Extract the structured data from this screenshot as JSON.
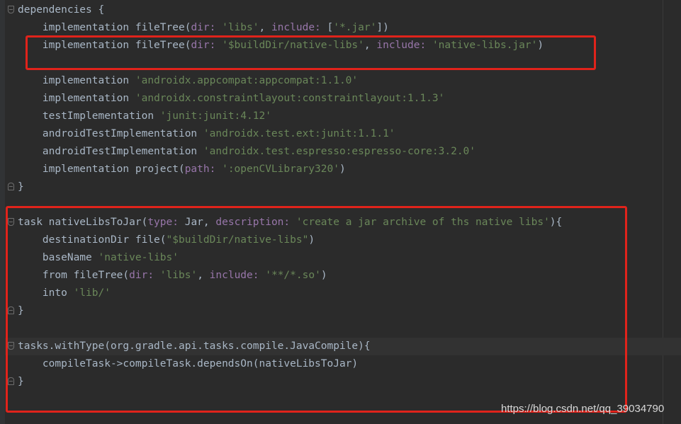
{
  "editor": {
    "lines": [
      {
        "tokens": [
          {
            "t": "dependencies ",
            "c": "plain"
          },
          {
            "t": "{",
            "c": "plain"
          }
        ]
      },
      {
        "tokens": [
          {
            "t": "    implementation fileTree(",
            "c": "plain"
          },
          {
            "t": "dir: ",
            "c": "param"
          },
          {
            "t": "'libs'",
            "c": "str"
          },
          {
            "t": ", ",
            "c": "plain"
          },
          {
            "t": "include: ",
            "c": "param"
          },
          {
            "t": "[",
            "c": "plain"
          },
          {
            "t": "'*.jar'",
            "c": "str"
          },
          {
            "t": "])",
            "c": "plain"
          }
        ]
      },
      {
        "tokens": [
          {
            "t": "    implementation fileTree(",
            "c": "plain"
          },
          {
            "t": "dir: ",
            "c": "param"
          },
          {
            "t": "'$buildDir/native-libs'",
            "c": "str"
          },
          {
            "t": ", ",
            "c": "plain"
          },
          {
            "t": "include: ",
            "c": "param"
          },
          {
            "t": "'native-libs.jar'",
            "c": "str"
          },
          {
            "t": ")",
            "c": "plain"
          }
        ]
      },
      {
        "tokens": []
      },
      {
        "tokens": [
          {
            "t": "    implementation ",
            "c": "plain"
          },
          {
            "t": "'androidx.appcompat:appcompat:1.1.0'",
            "c": "str"
          }
        ]
      },
      {
        "tokens": [
          {
            "t": "    implementation ",
            "c": "plain"
          },
          {
            "t": "'androidx.constraintlayout:constraintlayout:1.1.3'",
            "c": "str"
          }
        ]
      },
      {
        "tokens": [
          {
            "t": "    testImplementation ",
            "c": "plain"
          },
          {
            "t": "'junit:junit:4.12'",
            "c": "str"
          }
        ]
      },
      {
        "tokens": [
          {
            "t": "    androidTestImplementation ",
            "c": "plain"
          },
          {
            "t": "'androidx.test.ext:junit:1.1.1'",
            "c": "str"
          }
        ]
      },
      {
        "tokens": [
          {
            "t": "    androidTestImplementation ",
            "c": "plain"
          },
          {
            "t": "'androidx.test.espresso:espresso-core:3.2.0'",
            "c": "str"
          }
        ]
      },
      {
        "tokens": [
          {
            "t": "    implementation project(",
            "c": "plain"
          },
          {
            "t": "path: ",
            "c": "param"
          },
          {
            "t": "':openCVLibrary320'",
            "c": "str"
          },
          {
            "t": ")",
            "c": "plain"
          }
        ]
      },
      {
        "tokens": [
          {
            "t": "}",
            "c": "plain"
          }
        ]
      },
      {
        "tokens": []
      },
      {
        "tokens": [
          {
            "t": "task nativeLibsToJar(",
            "c": "plain"
          },
          {
            "t": "type: ",
            "c": "param"
          },
          {
            "t": "Jar, ",
            "c": "plain"
          },
          {
            "t": "description: ",
            "c": "param"
          },
          {
            "t": "'create a jar archive of ths native libs'",
            "c": "str"
          },
          {
            "t": "){",
            "c": "plain"
          }
        ]
      },
      {
        "tokens": [
          {
            "t": "    destinationDir file(",
            "c": "plain"
          },
          {
            "t": "\"$buildDir/native-libs\"",
            "c": "str"
          },
          {
            "t": ")",
            "c": "plain"
          }
        ]
      },
      {
        "tokens": [
          {
            "t": "    baseName ",
            "c": "plain"
          },
          {
            "t": "'native-libs'",
            "c": "str"
          }
        ]
      },
      {
        "tokens": [
          {
            "t": "    from fileTree(",
            "c": "plain"
          },
          {
            "t": "dir: ",
            "c": "param"
          },
          {
            "t": "'libs'",
            "c": "str"
          },
          {
            "t": ", ",
            "c": "plain"
          },
          {
            "t": "include: ",
            "c": "param"
          },
          {
            "t": "'**/*.so'",
            "c": "str"
          },
          {
            "t": ")",
            "c": "plain"
          }
        ]
      },
      {
        "tokens": [
          {
            "t": "    into ",
            "c": "plain"
          },
          {
            "t": "'lib/'",
            "c": "str"
          }
        ]
      },
      {
        "tokens": [
          {
            "t": "}",
            "c": "plain"
          }
        ]
      },
      {
        "tokens": []
      },
      {
        "tokens": [
          {
            "t": "tasks.withType(org.gradle.api.tasks.compile.JavaCompile){",
            "c": "plain"
          }
        ]
      },
      {
        "tokens": [
          {
            "t": "    compileTask->compileTask.dependsOn(nativeLibsToJar)",
            "c": "plain"
          }
        ]
      },
      {
        "tokens": [
          {
            "t": "}",
            "c": "plain"
          }
        ]
      }
    ]
  },
  "colors": {
    "background": "#2b2b2b",
    "plain": "#a9b7c6",
    "string": "#6a8759",
    "param": "#9876aa",
    "highlight_box": "#e0231b"
  },
  "watermark": "https://blog.csdn.net/qq_39034790"
}
